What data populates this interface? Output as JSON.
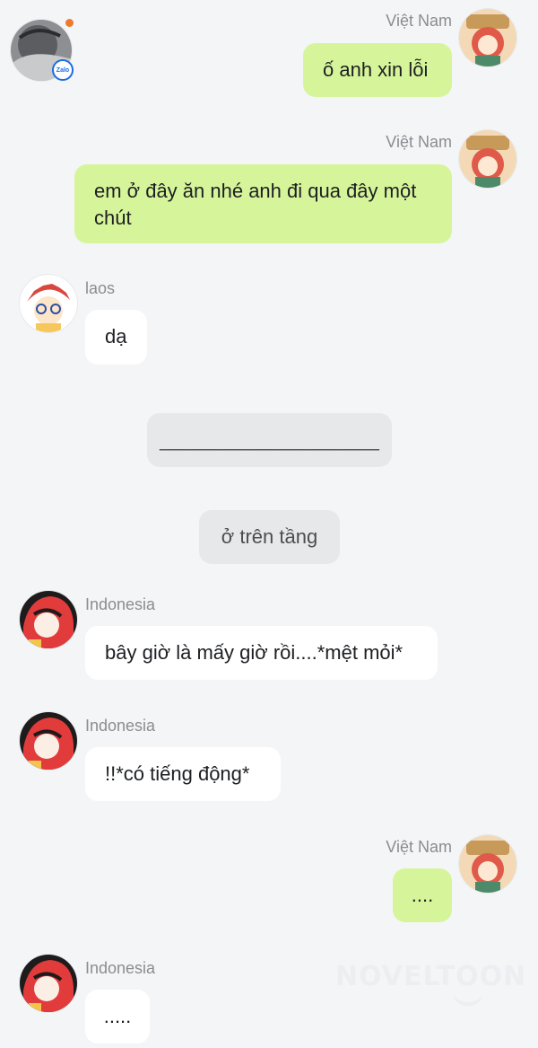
{
  "watermark": "NOVELTOON",
  "app_badge": "Zalo",
  "messages": [
    {
      "sender": "Việt Nam",
      "text": "ố anh xin lỗi",
      "direction": "sent"
    },
    {
      "sender": "Việt Nam",
      "text": "em ở đây ăn nhé anh đi qua đây một chút",
      "direction": "sent"
    },
    {
      "sender": "laos",
      "text": "dạ",
      "direction": "received"
    },
    {
      "text": "____________________",
      "direction": "system"
    },
    {
      "text": "ở trên tầng",
      "direction": "system"
    },
    {
      "sender": "Indonesia",
      "text": "bây giờ là mấy giờ rồi....*mệt mỏi*",
      "direction": "received"
    },
    {
      "sender": "Indonesia",
      "text": "!!*có tiếng động*",
      "direction": "received"
    },
    {
      "sender": "Việt Nam",
      "text": "....",
      "direction": "sent"
    },
    {
      "sender": "Indonesia",
      "text": ".....",
      "direction": "received"
    }
  ],
  "colors": {
    "background": "#f4f5f7",
    "sent_bubble": "#d6f59a",
    "received_bubble": "#ffffff",
    "system_bubble": "#e7e8ea",
    "notification_dot": "#f07a2c"
  }
}
